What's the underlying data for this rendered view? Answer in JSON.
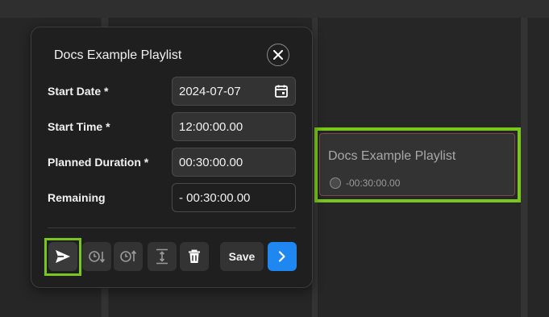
{
  "dialog": {
    "title": "Docs Example Playlist",
    "fields": [
      {
        "label": "Start Date *",
        "value": "2024-07-07"
      },
      {
        "label": "Start Time *",
        "value": "12:00:00.00"
      },
      {
        "label": "Planned Duration *",
        "value": "00:30:00.00"
      },
      {
        "label": "Remaining",
        "value": "- 00:30:00.00"
      }
    ],
    "toolbar": {
      "send_icon": "send-icon",
      "align_end_icon": "clock-arrow-down-icon",
      "align_start_icon": "clock-arrow-up-icon",
      "fit_icon": "fit-height-icon",
      "delete_icon": "trash-icon",
      "save_label": "Save",
      "next_icon": "chevron-right-icon"
    }
  },
  "timeline_block": {
    "title": "Docs Example Playlist",
    "time": "-00:30:00.00"
  },
  "colors": {
    "accent": "#1e88f0",
    "highlight": "#79c61c",
    "dialog_bg": "#1f1f1f",
    "input_bg": "#333333"
  }
}
